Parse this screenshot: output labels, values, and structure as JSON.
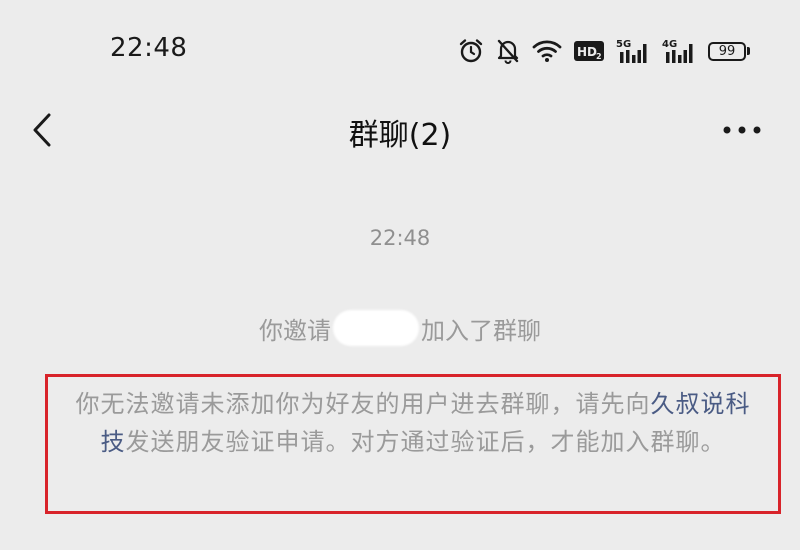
{
  "status_bar": {
    "time": "22:48",
    "battery": "99",
    "net1": "5G",
    "net2": "4G",
    "hd": "HD"
  },
  "nav": {
    "title": "群聊(2)"
  },
  "chat": {
    "timestamp": "22:48",
    "invite_prefix": "你邀请",
    "invite_suffix": "加入了群聊",
    "notice_part1": "你无法邀请未添加你为好友的用户进去群聊，请先向",
    "notice_link": "久叔说科技",
    "notice_part2": "发送朋友验证申请。对方通过验证后，才能加入群聊。"
  },
  "colors": {
    "background": "#ececec",
    "link": "#4a5b84",
    "highlight_border": "#d8232a",
    "system_text": "#9a9a9a"
  }
}
